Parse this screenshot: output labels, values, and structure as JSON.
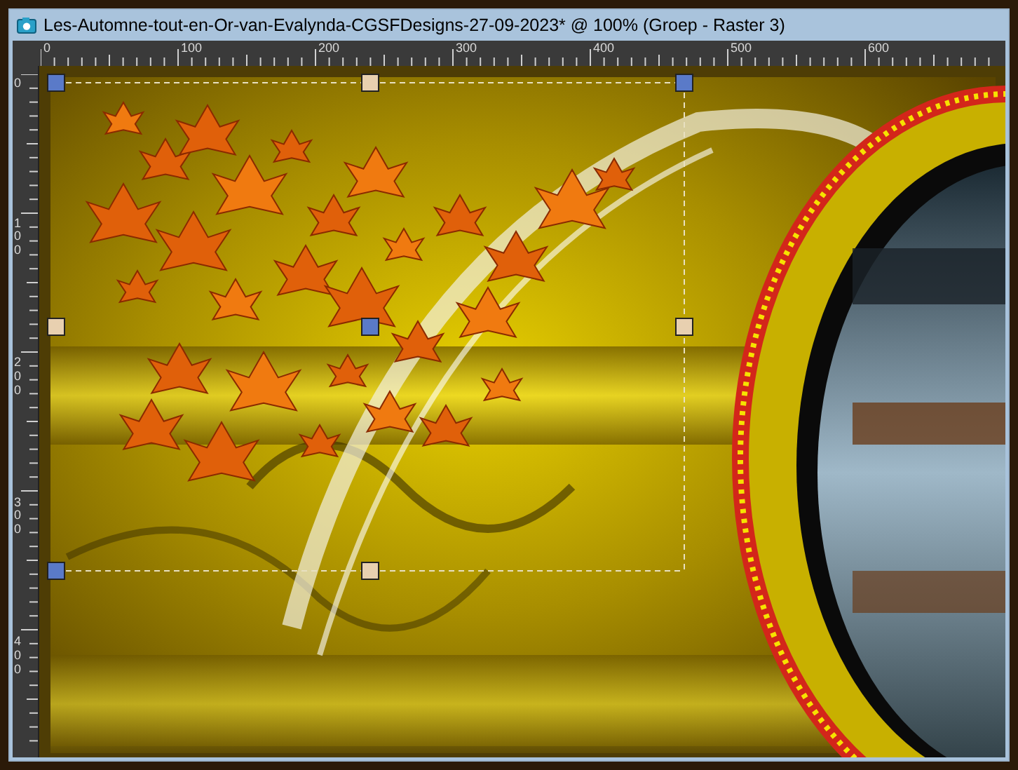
{
  "window": {
    "title": "Les-Automne-tout-en-Or-van-Evalynda-CGSFDesigns-27-09-2023* @ 100% (Groep - Raster 3)"
  },
  "rulers": {
    "horizontal": [
      "0",
      "100",
      "200",
      "300",
      "400",
      "500",
      "600"
    ],
    "vertical": [
      "0",
      "100",
      "200",
      "300",
      "400"
    ]
  }
}
